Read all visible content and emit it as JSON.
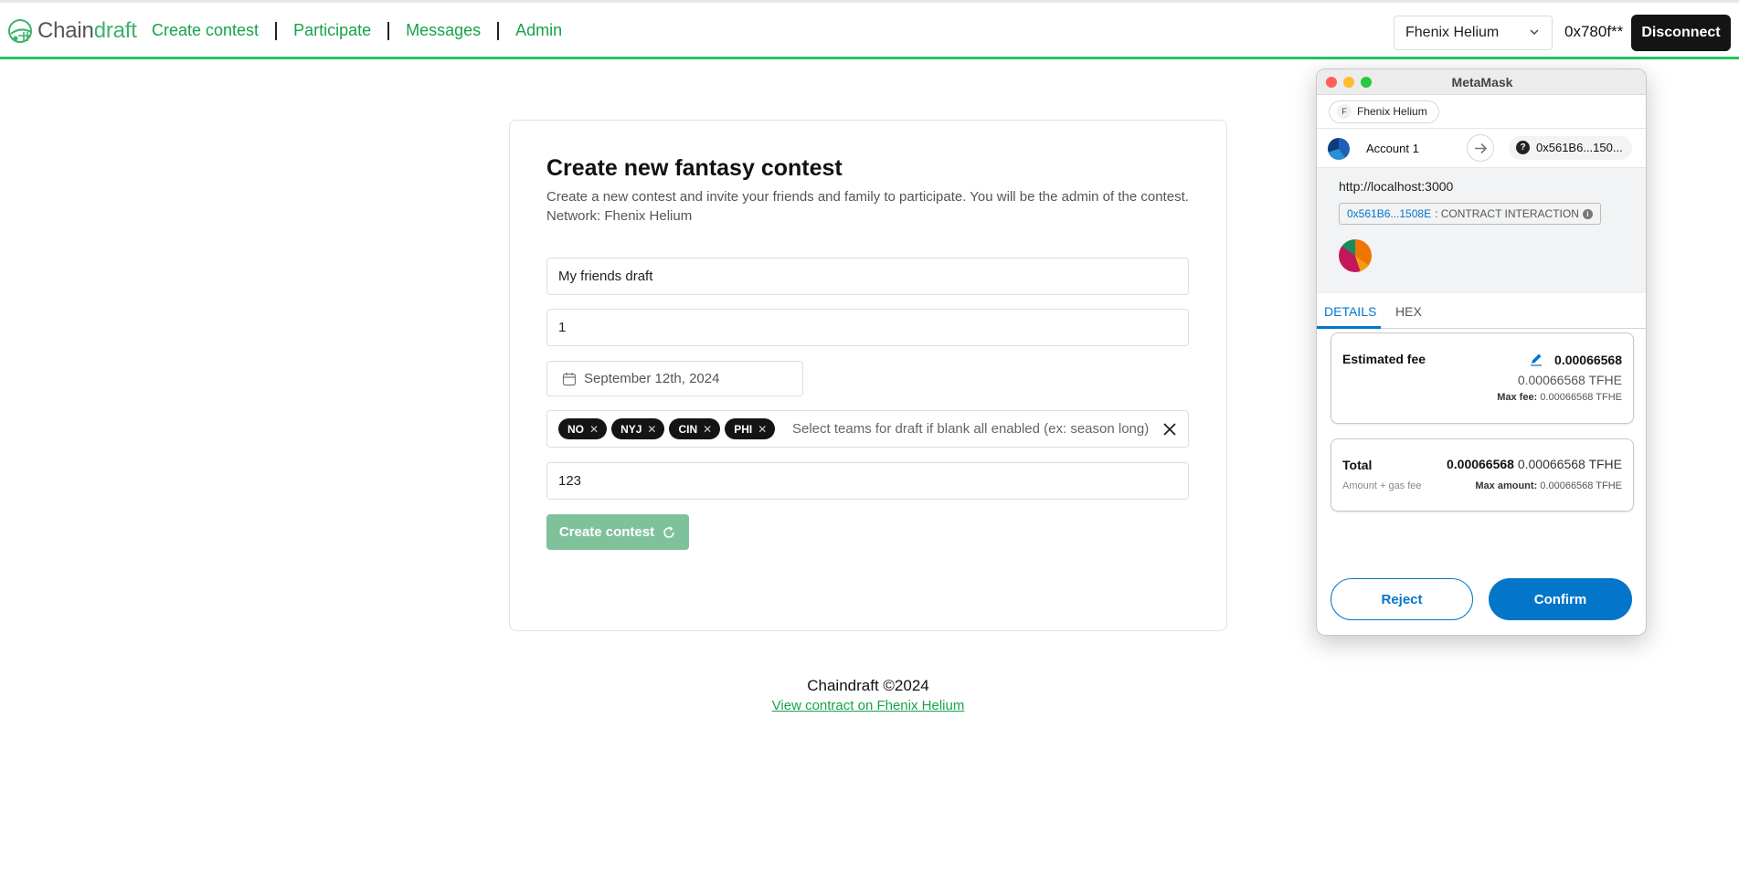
{
  "nav": {
    "logo_prefix": "Chain",
    "logo_suffix": "draft",
    "links": [
      "Create contest",
      "Participate",
      "Messages",
      "Admin"
    ],
    "network": "Fhenix Helium",
    "address": "0x780f**",
    "disconnect_label": "Disconnect",
    "accent_color": "#16a34a"
  },
  "form": {
    "title": "Create new fantasy contest",
    "description": "Create a new contest and invite your friends and family to participate. You will be the admin of the contest.",
    "network_line": "Network: Fhenix Helium",
    "contest_name": "My friends draft",
    "week": "1",
    "date": "September 12th, 2024",
    "teams": [
      "NO",
      "NYJ",
      "CIN",
      "PHI"
    ],
    "teams_placeholder": "Select teams for draft if blank all enabled (ex: season long)",
    "code": "123",
    "submit_label": "Create contest"
  },
  "footer": {
    "title": "Chaindraft ©2024",
    "link": "View contract on Fhenix Helium"
  },
  "metamask": {
    "window_title": "MetaMask",
    "network": "Fhenix Helium",
    "network_badge": "F",
    "account": "Account 1",
    "to_address": "0x561B6...150...",
    "origin": "http://localhost:3000",
    "contract_address": "0x561B6...1508E",
    "contract_label": ": CONTRACT INTERACTION",
    "tabs": [
      "DETAILS",
      "HEX"
    ],
    "estimated_fee_label": "Estimated fee",
    "estimated_fee": "0.00066568",
    "estimated_fee_token": "0.00066568 TFHE",
    "max_fee_label": "Max fee:",
    "max_fee": "0.00066568 TFHE",
    "total_label": "Total",
    "total_bold": "0.00066568",
    "total_token": "0.00066568 TFHE",
    "total_sub": "Amount + gas fee",
    "max_amount_label": "Max amount:",
    "max_amount": "0.00066568 TFHE",
    "reject_label": "Reject",
    "confirm_label": "Confirm",
    "accent_color": "#0376c9"
  }
}
